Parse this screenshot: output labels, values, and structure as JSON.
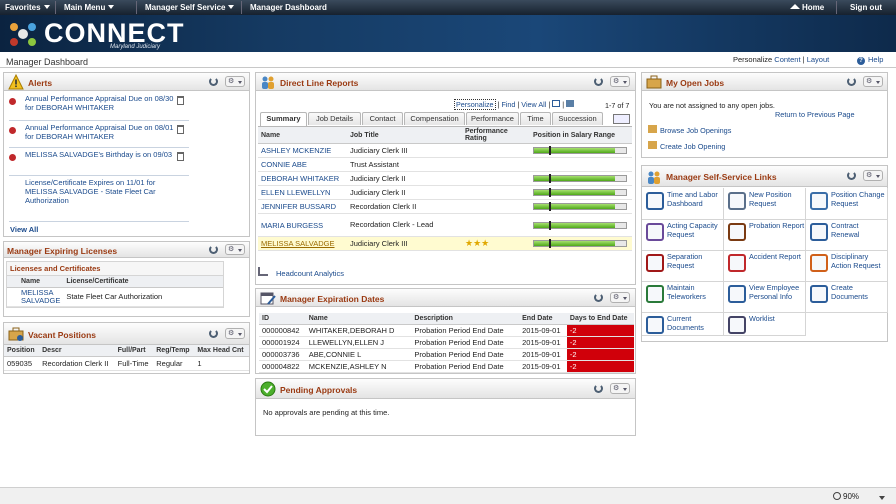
{
  "topnav": {
    "favorites": "Favorites",
    "main_menu": "Main Menu",
    "manager_self_service": "Manager Self Service",
    "manager_dashboard": "Manager Dashboard",
    "home": "Home",
    "sign_out": "Sign out"
  },
  "banner": {
    "logo_text": "CONNECT",
    "logo_sub": "Maryland Judiciary"
  },
  "subbar": {
    "title": "Manager Dashboard",
    "personalize": "Personalize",
    "content": "Content",
    "layout": "Layout",
    "help": "Help"
  },
  "alerts": {
    "title": "Alerts",
    "items": [
      {
        "text": "Annual Performance Appraisal Due on 08/30 for DEBORAH WHITAKER",
        "icon": "error-icon"
      },
      {
        "text": "Annual Performance Appraisal Due on 08/01 for DEBORAH WHITAKER",
        "icon": "error-icon"
      },
      {
        "text": "MELISSA SALVADGE's Birthday is on 09/03",
        "icon": "error-icon"
      },
      {
        "text": "License/Certificate Expires on 11/01 for MELISSA SALVADGE - State Fleet Car Authorization",
        "icon": ""
      }
    ],
    "view_all": "View All"
  },
  "licenses": {
    "title": "Manager Expiring Licenses",
    "subtitle": "Licenses and Certificates",
    "col_name": "Name",
    "col_cert": "License/Certificate",
    "row": {
      "name": "MELISSA SALVADGE",
      "cert": "State Fleet Car Authorization"
    }
  },
  "vacant": {
    "title": "Vacant Positions",
    "cols": [
      "Position",
      "Descr",
      "Full/Part",
      "Reg/Temp",
      "Max Head Cnt"
    ],
    "row": [
      "059035",
      "Recordation Clerk II",
      "Full-Time",
      "Regular",
      "1"
    ]
  },
  "direct": {
    "title": "Direct Line Reports",
    "personalize": "Personalize",
    "find": "Find",
    "view_all": "View All",
    "count": "1-7 of 7",
    "tabs": [
      "Summary",
      "Job Details",
      "Contact",
      "Compensation",
      "Performance",
      "Time",
      "Succession"
    ],
    "cols": [
      "Name",
      "Job Title",
      "Performance Rating",
      "Position in Salary Range"
    ],
    "rows": [
      {
        "name": "ASHLEY MCKENZIE",
        "title": "Judiciary Clerk III",
        "stars": "",
        "range": 0.88
      },
      {
        "name": "CONNIE ABE",
        "title": "Trust Assistant",
        "stars": "",
        "range": 0
      },
      {
        "name": "DEBORAH WHITAKER",
        "title": "Judiciary Clerk II",
        "stars": "",
        "range": 0.88
      },
      {
        "name": "ELLEN LLEWELLYN",
        "title": "Judiciary Clerk II",
        "stars": "",
        "range": 0.88
      },
      {
        "name": "JENNIFER BUSSARD",
        "title": "Recordation Clerk II",
        "stars": "",
        "range": 0.88
      },
      {
        "name": "MARIA BURGESS",
        "title": "Recordation Clerk - Lead",
        "stars": "",
        "range": 0.88
      },
      {
        "name": "MELISSA SALVADGE",
        "title": "Judiciary Clerk III",
        "stars": "★★★",
        "range": 0.88
      }
    ],
    "headcount": "Headcount Analytics"
  },
  "expiration": {
    "title": "Manager Expiration Dates",
    "cols": [
      "ID",
      "Name",
      "Description",
      "End Date",
      "Days to End Date"
    ],
    "rows": [
      [
        "000000842",
        "WHITAKER,DEBORAH D",
        "Probation Period End Date",
        "2015-09-01",
        "-2"
      ],
      [
        "000001924",
        "LLEWELLYN,ELLEN J",
        "Probation Period End Date",
        "2015-09-01",
        "-2"
      ],
      [
        "000003736",
        "ABE,CONNIE L",
        "Probation Period End Date",
        "2015-09-01",
        "-2"
      ],
      [
        "000004822",
        "MCKENZIE,ASHLEY N",
        "Probation Period End Date",
        "2015-09-01",
        "-2"
      ]
    ]
  },
  "pending": {
    "title": "Pending Approvals",
    "message": "No approvals are pending at this time."
  },
  "jobs": {
    "title": "My Open Jobs",
    "message": "You are not assigned to any open jobs.",
    "return": "Return to Previous Page",
    "browse": "Browse Job Openings",
    "create": "Create Job Opening"
  },
  "selfservice": {
    "title": "Manager Self-Service Links",
    "links": [
      {
        "label": "Time and Labor Dashboard",
        "icon": "time-labor-icon"
      },
      {
        "label": "New Position Request",
        "icon": "new-position-icon"
      },
      {
        "label": "Position Change Request",
        "icon": "position-change-icon"
      },
      {
        "label": "Acting Capacity Request",
        "icon": "acting-capacity-icon"
      },
      {
        "label": "Probation Report",
        "icon": "probation-icon"
      },
      {
        "label": "Contract Renewal",
        "icon": "contract-icon"
      },
      {
        "label": "Separation Request",
        "icon": "separation-icon"
      },
      {
        "label": "Accident Report",
        "icon": "accident-icon"
      },
      {
        "label": "Disciplinary Action Request",
        "icon": "disciplinary-icon"
      },
      {
        "label": "Maintain Teleworkers",
        "icon": "telework-icon"
      },
      {
        "label": "View Employee Personal Info",
        "icon": "personal-info-icon"
      },
      {
        "label": "Create Documents",
        "icon": "create-docs-icon"
      },
      {
        "label": "Current Documents",
        "icon": "current-docs-icon"
      },
      {
        "label": "Worklist",
        "icon": "worklist-icon"
      }
    ]
  },
  "status": {
    "zoom": "90%"
  }
}
